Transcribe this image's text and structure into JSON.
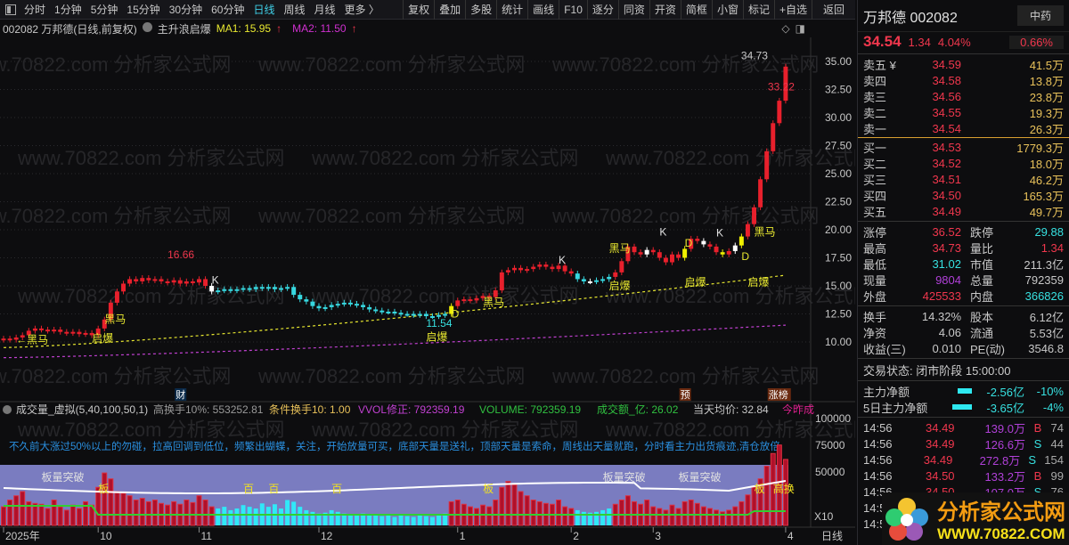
{
  "toolbar": {
    "periods": [
      "分时",
      "1分钟",
      "5分钟",
      "15分钟",
      "30分钟",
      "60分钟",
      "日线",
      "周线",
      "月线",
      "更多 〉"
    ],
    "active": "日线",
    "tools": [
      "复权",
      "叠加",
      "多股",
      "统计",
      "画线",
      "F10",
      "逐分",
      "同资",
      "开资",
      "简框",
      "小窗",
      "标记",
      "+自选",
      "返回"
    ]
  },
  "info": {
    "title": "002082 万邦德(日线,前复权)",
    "indicator": "主升浪启爆",
    "ma1": "MA1: 15.95",
    "ma2": "MA2: 11.50",
    "ma1_arrow": "↑",
    "ma2_arrow": "↑"
  },
  "watermark": "www.70822.com 分析家公式网",
  "price_axis": [
    "35.00",
    "32.50",
    "30.00",
    "27.50",
    "25.00",
    "22.50",
    "20.00",
    "17.50",
    "15.00",
    "12.50",
    "10.00"
  ],
  "chart_data": {
    "type": "candlestick",
    "closes": [
      10.3,
      10.2,
      10.4,
      10.6,
      11.0,
      11.2,
      11.1,
      11.0,
      11.1,
      10.9,
      10.8,
      10.9,
      10.7,
      10.8,
      10.6,
      11.2,
      12.0,
      13.5,
      14.5,
      15.2,
      15.6,
      15.4,
      15.7,
      15.5,
      15.6,
      15.4,
      15.3,
      15.5,
      15.2,
      15.4,
      15.3,
      15.6,
      15.0,
      14.5,
      14.6,
      14.7,
      14.6,
      14.7,
      14.8,
      14.7,
      14.9,
      14.8,
      14.9,
      14.7,
      14.8,
      14.9,
      14.2,
      13.8,
      13.6,
      13.2,
      13.0,
      13.1,
      13.3,
      13.4,
      13.5,
      13.4,
      13.3,
      13.1,
      12.9,
      12.8,
      12.7,
      12.7,
      12.6,
      12.5,
      12.5,
      12.4,
      12.5,
      12.3,
      12.3,
      12.4,
      12.5,
      13.2,
      13.7,
      13.8,
      13.7,
      13.9,
      14.1,
      14.0,
      14.6,
      16.2,
      16.4,
      16.6,
      16.4,
      16.5,
      16.7,
      16.9,
      16.7,
      16.5,
      16.8,
      16.3,
      16.1,
      15.6,
      15.4,
      15.4,
      15.5,
      15.6,
      15.8,
      16.2,
      17.2,
      18.5,
      18.0,
      17.8,
      18.2,
      18.0,
      17.5,
      17.1,
      17.8,
      17.5,
      18.3,
      19.2,
      19.0,
      18.7,
      18.5,
      18.0,
      17.8,
      18.1,
      18.6,
      19.4,
      20.5,
      22.0,
      24.5,
      27.0,
      29.5,
      31.5,
      34.54
    ],
    "cyan_ranges": [
      [
        34,
        70
      ],
      [
        91,
        96
      ]
    ],
    "yellow_bars": [
      71,
      108,
      114,
      117
    ],
    "white_bars": [
      33,
      93,
      102,
      111,
      116
    ],
    "ma1": {
      "name": "MA1",
      "start": 9.5,
      "end": 15.95,
      "color": "#e8e830"
    },
    "ma2": {
      "name": "MA2",
      "start": 8.6,
      "end": 11.5,
      "color": "#c040d0"
    },
    "ylim": [
      8,
      36
    ],
    "volumes": [
      22,
      30,
      35,
      40,
      28,
      26,
      25,
      20,
      30,
      22,
      18,
      24,
      20,
      28,
      24,
      45,
      62,
      55,
      40,
      38,
      35,
      30,
      32,
      28,
      30,
      26,
      24,
      28,
      25,
      30,
      27,
      35,
      30,
      22,
      20,
      22,
      18,
      20,
      24,
      22,
      20,
      26,
      22,
      25,
      20,
      30,
      28,
      22,
      18,
      16,
      14,
      15,
      18,
      16,
      14,
      13,
      12,
      14,
      12,
      13,
      11,
      12,
      10,
      12,
      11,
      10,
      12,
      11,
      10,
      12,
      14,
      28,
      30,
      25,
      22,
      20,
      24,
      22,
      30,
      45,
      52,
      48,
      40,
      35,
      30,
      28,
      26,
      25,
      30,
      22,
      20,
      18,
      16,
      15,
      16,
      18,
      20,
      25,
      30,
      35,
      28,
      25,
      30,
      22,
      20,
      18,
      24,
      20,
      28,
      30,
      26,
      22,
      20,
      18,
      16,
      18,
      22,
      28,
      36,
      45,
      55,
      70,
      85,
      95,
      78
    ],
    "vol_ma_white": [
      40,
      38
    ],
    "annotations": [
      {
        "i": 26,
        "p": 16.66,
        "text": "16.66",
        "color": "#f0374d",
        "dy": -10
      },
      {
        "i": 67,
        "p": 12.3,
        "text": "11.54",
        "color": "#37e0e0",
        "dy": 12
      },
      {
        "i": 124,
        "p": 34.73,
        "text": "34.73",
        "color": "#c8c8c8",
        "dy": -6,
        "dx": -50
      },
      {
        "i": 124,
        "p": 33.22,
        "text": "33.22",
        "color": "#f0374d",
        "dy": 10,
        "dx": -20
      },
      {
        "i": 2,
        "p": 9.9,
        "text": "←黑马",
        "color": "#e8e830",
        "dy": 0
      },
      {
        "i": 16,
        "p": 11.7,
        "text": "黑马",
        "color": "#e8e830",
        "dy": 0
      },
      {
        "i": 76,
        "p": 13.2,
        "text": "黑马",
        "color": "#e8e830",
        "dy": 0
      },
      {
        "i": 96,
        "p": 18.0,
        "text": "黑马",
        "color": "#e8e830",
        "dy": 0
      },
      {
        "i": 119,
        "p": 19.5,
        "text": "黑马",
        "color": "#e8e830",
        "dy": 0
      },
      {
        "i": 14,
        "p": 10.0,
        "text": "启爆",
        "color": "#e8e830",
        "dy": 0
      },
      {
        "i": 67,
        "p": 10.1,
        "text": "启爆",
        "color": "#e8e830",
        "dy": 0
      },
      {
        "i": 96,
        "p": 14.7,
        "text": "启爆",
        "color": "#e8e830",
        "dy": 0
      },
      {
        "i": 108,
        "p": 15.0,
        "text": "启爆",
        "color": "#e8e830",
        "dy": 0
      },
      {
        "i": 118,
        "p": 15.0,
        "text": "启爆",
        "color": "#e8e830",
        "dy": 0
      },
      {
        "i": 33,
        "p": 15.2,
        "text": "K",
        "color": "#e0e0e0",
        "dy": 0
      },
      {
        "i": 88,
        "p": 17.0,
        "text": "K",
        "color": "#e0e0e0",
        "dy": 0
      },
      {
        "i": 104,
        "p": 19.5,
        "text": "K",
        "color": "#e0e0e0",
        "dy": 0
      },
      {
        "i": 113,
        "p": 19.4,
        "text": "K",
        "color": "#e0e0e0",
        "dy": 0
      },
      {
        "i": 71,
        "p": 12.2,
        "text": "D",
        "color": "#e8e830",
        "dy": 0
      },
      {
        "i": 108,
        "p": 18.5,
        "text": "D",
        "color": "#e8e830",
        "dy": 0
      },
      {
        "i": 117,
        "p": 17.3,
        "text": "D",
        "color": "#e8e830",
        "dy": 0
      }
    ],
    "x_ticks": [
      {
        "i": 0,
        "label": "2025年"
      },
      {
        "i": 15,
        "label": "10"
      },
      {
        "i": 31,
        "label": "11"
      },
      {
        "i": 50,
        "label": "12"
      },
      {
        "i": 72,
        "label": "1"
      },
      {
        "i": 90,
        "label": "2"
      },
      {
        "i": 103,
        "label": "3"
      },
      {
        "i": 124,
        "label": "4"
      }
    ],
    "markers": [
      {
        "i": 28,
        "text": "财"
      },
      {
        "i": 108,
        "text": "预"
      },
      {
        "i": 122,
        "text": "涨榜"
      }
    ]
  },
  "volume_panel": {
    "title": "成交量_虚拟(5,40,100,50,1)",
    "hsl": "高换手10%: 553252.81",
    "cond": "条件换手10: 1.00",
    "vvol": "VVOL修正: 792359.19",
    "volume": "VOLUME: 792359.19",
    "amount": "成交额_亿: 26.02",
    "avg": "当天均价: 32.84",
    "extra": "今昨成",
    "tip": "不久前大涨过50%以上的勿碰，拉高回调到低位，频繁出蝴蝶，关注，开始放量可买，底部天量是送礼，顶部天量是索命，周线出天量就跑，分时看主力出货痕迹,清仓放倍",
    "axis": [
      "100000",
      "75000",
      "50000"
    ],
    "x10": "X10",
    "period": "日线",
    "tags": [
      {
        "i": 6,
        "text": "板量突破"
      },
      {
        "i": 15,
        "text": "板"
      },
      {
        "i": 38,
        "text": "百"
      },
      {
        "i": 42,
        "text": "百"
      },
      {
        "i": 52,
        "text": "百"
      },
      {
        "i": 76,
        "text": "板"
      },
      {
        "i": 95,
        "text": "板量突破"
      },
      {
        "i": 107,
        "text": "板量突破"
      },
      {
        "i": 119,
        "text": "板"
      },
      {
        "i": 122,
        "text": "高换"
      }
    ]
  },
  "quote": {
    "name": "万邦德 002082",
    "sector": "中药",
    "sector_pct": "0.66%",
    "price": "34.54",
    "chg": "1.34",
    "pct": "4.04%",
    "asks": [
      {
        "l": "卖五 ¥",
        "p": "34.59",
        "v": "41.5万"
      },
      {
        "l": "卖四",
        "p": "34.58",
        "v": "13.8万"
      },
      {
        "l": "卖三",
        "p": "34.56",
        "v": "23.8万"
      },
      {
        "l": "卖二",
        "p": "34.55",
        "v": "19.3万"
      },
      {
        "l": "卖一",
        "p": "34.54",
        "v": "26.3万"
      }
    ],
    "bids": [
      {
        "l": "买一",
        "p": "34.53",
        "v": "1779.3万"
      },
      {
        "l": "买二",
        "p": "34.52",
        "v": "18.0万"
      },
      {
        "l": "买三",
        "p": "34.51",
        "v": "46.2万"
      },
      {
        "l": "买四",
        "p": "34.50",
        "v": "165.3万"
      },
      {
        "l": "买五",
        "p": "34.49",
        "v": "49.7万"
      }
    ],
    "stats1": [
      [
        "涨停",
        "36.52",
        "跌停",
        "29.88"
      ],
      [
        "最高",
        "34.73",
        "量比",
        "1.34"
      ],
      [
        "最低",
        "31.02",
        "市值",
        "211.3亿"
      ],
      [
        "现量",
        "9804",
        "总量",
        "792359"
      ],
      [
        "外盘",
        "425533",
        "内盘",
        "366826"
      ]
    ],
    "stats2": [
      [
        "换手",
        "14.32%",
        "股本",
        "6.12亿"
      ],
      [
        "净资",
        "4.06",
        "流通",
        "5.53亿"
      ],
      [
        "收益(三)",
        "0.010",
        "PE(动)",
        "3546.8"
      ]
    ],
    "status": "交易状态: 闭市阶段 15:00:00",
    "flow": [
      {
        "l": "主力净额",
        "v": "-2.56亿",
        "p": "-10%"
      },
      {
        "l": "5日主力净额",
        "v": "-3.65亿",
        "p": "-4%"
      }
    ],
    "ticks": [
      [
        "14:56",
        "34.49",
        "139.0万",
        "B",
        "74"
      ],
      [
        "14:56",
        "34.49",
        "126.6万",
        "S",
        "44"
      ],
      [
        "14:56",
        "34.49",
        "272.8万",
        "S",
        "154"
      ],
      [
        "14:56",
        "34.50",
        "133.2万",
        "B",
        "99"
      ],
      [
        "14:56",
        "34.50",
        "107.0万",
        "S",
        "76"
      ],
      [
        "14:5",
        "",
        "",
        "",
        ""
      ],
      [
        "14:5",
        "",
        "",
        "",
        ""
      ]
    ]
  },
  "logo": {
    "cn": "分析家公式网",
    "url": "WWW.70822.COM"
  }
}
